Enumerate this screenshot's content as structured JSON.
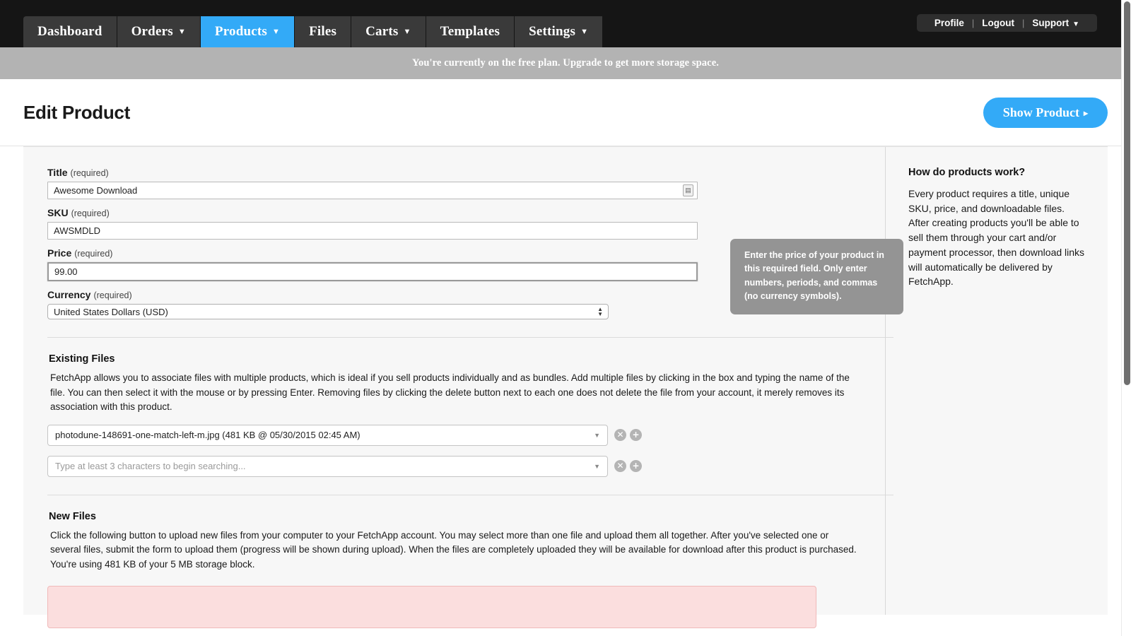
{
  "nav": {
    "tabs": [
      {
        "label": "Dashboard",
        "caret": false,
        "active": false
      },
      {
        "label": "Orders",
        "caret": true,
        "active": false
      },
      {
        "label": "Products",
        "caret": true,
        "active": true
      },
      {
        "label": "Files",
        "caret": false,
        "active": false
      },
      {
        "label": "Carts",
        "caret": true,
        "active": false
      },
      {
        "label": "Templates",
        "caret": false,
        "active": false
      },
      {
        "label": "Settings",
        "caret": true,
        "active": false
      }
    ],
    "account": {
      "profile": "Profile",
      "logout": "Logout",
      "support": "Support",
      "separator": "|",
      "caret_icon": "chevron-down-icon"
    },
    "active_color": "#33aaf7",
    "bar_color": "#151515",
    "tab_color": "#3a3a3a"
  },
  "banner": {
    "text": "You're currently on the free plan. Upgrade to get more storage space.",
    "bg_color": "#b3b3b3"
  },
  "page": {
    "title": "Edit Product",
    "show_product_label": "Show Product",
    "show_product_arrow": "▸",
    "accent_color": "#33aaf7"
  },
  "form": {
    "title": {
      "label": "Title",
      "required": "(required)",
      "value": "Awesome Download",
      "grabber_icon": "resize-grabber-icon"
    },
    "sku": {
      "label": "SKU",
      "required": "(required)",
      "value": "AWSMDLD"
    },
    "price": {
      "label": "Price",
      "required": "(required)",
      "value": "99.00",
      "focused": true
    },
    "currency": {
      "label": "Currency",
      "required": "(required)",
      "value": "United States Dollars (USD)",
      "stepper_icon": "up-down-stepper-icon"
    },
    "tooltip": {
      "text": "Enter the price of your product in this required field. Only enter numbers, periods, and commas (no currency symbols).",
      "bg_color": "#949494"
    }
  },
  "existing_files": {
    "heading": "Existing Files",
    "description": "FetchApp allows you to associate files with multiple products, which is ideal if you sell products individually and as bundles. Add multiple files by clicking in the box and typing the name of the file. You can then select it with the mouse or by pressing Enter. Removing files by clicking the delete button next to each one does not delete the file from your account, it merely removes its association with this product.",
    "rows": [
      {
        "value": "photodune-148691-one-match-left-m.jpg (481 KB @ 05/30/2015 02:45 AM)",
        "is_placeholder": false,
        "caret_icon": "chevron-down-icon",
        "remove_icon": "remove-circle-icon",
        "add_icon": "add-circle-icon",
        "remove_glyph": "✕",
        "add_glyph": "+"
      },
      {
        "value": "Type at least 3 characters to begin searching...",
        "is_placeholder": true,
        "caret_icon": "chevron-down-icon",
        "remove_icon": "remove-circle-icon",
        "add_icon": "add-circle-icon",
        "remove_glyph": "✕",
        "add_glyph": "+"
      }
    ]
  },
  "new_files": {
    "heading": "New Files",
    "description": "Click the following button to upload new files from your computer to your FetchApp account. You may select more than one file and upload them all together. After you've selected one or several files, submit the form to upload them (progress will be shown during upload). When the files are completely uploaded they will be available for download after this product is purchased. You're using 481 KB of your 5 MB storage block.",
    "upload_area_color": "#fbdede"
  },
  "help": {
    "heading": "How do products work?",
    "body": "Every product requires a title, unique SKU, price, and downloadable files. After creating products you'll be able to sell them through your cart and/or payment processor, then download links will automatically be delivered by FetchApp."
  },
  "scrollbar": {
    "thumb_color": "#6f6f6f"
  }
}
